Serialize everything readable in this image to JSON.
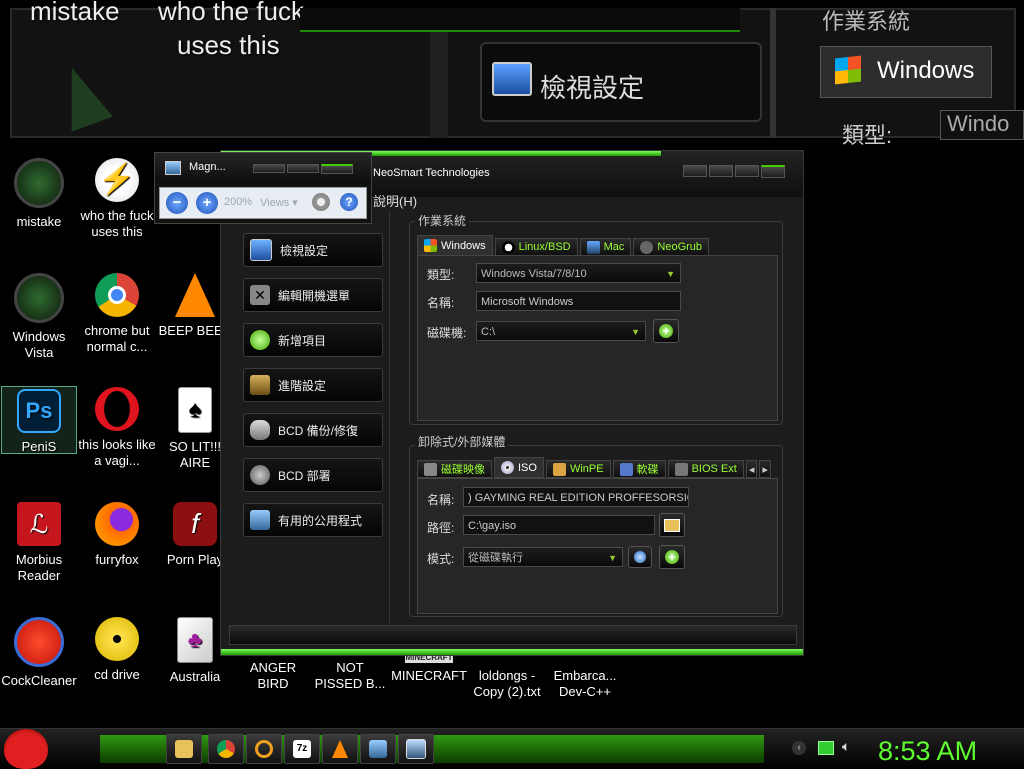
{
  "lens": {
    "texts": [
      "mistake",
      "who the fuck",
      "uses this"
    ],
    "view_settings": "檢視設定",
    "os_group_label": "作業系統",
    "os_tab": "Windows",
    "type_label": "類型:",
    "type_value": "Windo"
  },
  "desktop_icons": [
    {
      "label": "mistake"
    },
    {
      "label": "who the fuck uses this"
    },
    {
      "label": "Windows Vista"
    },
    {
      "label": "chrome but normal c..."
    },
    {
      "label": "BEEP BEEP"
    },
    {
      "label": "PeniS"
    },
    {
      "label": "this looks like a vagi..."
    },
    {
      "label": "SO LIT!!! AIRE"
    },
    {
      "label": "Morbius Reader"
    },
    {
      "label": "furryfox"
    },
    {
      "label": "Porn Play"
    },
    {
      "label": "CockCleaner"
    },
    {
      "label": "cd drive"
    },
    {
      "label": "Australia"
    },
    {
      "label": "ANGER BIRD"
    },
    {
      "label": "NOT PISSED B..."
    },
    {
      "label": "MINECRAFT"
    },
    {
      "label": "loldongs - Copy (2).txt"
    },
    {
      "label": "Embarca... Dev-C++"
    }
  ],
  "minecraft_badge": "MINECRAFT",
  "magnifier": {
    "title": "Magn...",
    "zoom": "200%",
    "views": "Views"
  },
  "easybcd": {
    "title": "NeoSmart Technologies",
    "menu_help": "說明(H)",
    "sidebar": [
      "檢視設定",
      "編輯開機選單",
      "新增項目",
      "進階設定",
      "BCD 備份/修復",
      "BCD 部署",
      "有用的公用程式"
    ],
    "os_group": {
      "title": "作業系統",
      "tabs": [
        "Windows",
        "Linux/BSD",
        "Mac",
        "NeoGrub"
      ],
      "type_label": "類型:",
      "type_value": "Windows Vista/7/8/10",
      "name_label": "名稱:",
      "name_value": "Microsoft Windows",
      "drive_label": "磁碟機:",
      "drive_value": "C:\\"
    },
    "removable_group": {
      "title": "卸除式/外部媒體",
      "tabs": [
        "磁碟映像",
        "ISO",
        "WinPE",
        "軟碟",
        "BIOS Ext"
      ],
      "name_label": "名稱:",
      "name_value": ") GAYMING REAL EDITION PROFFESORSIOA",
      "path_label": "路徑:",
      "path_value": "C:\\gay.iso",
      "mode_label": "模式:",
      "mode_value": "從磁碟執行"
    }
  },
  "clock": "8:53 AM",
  "colors": {
    "accent": "#5fff2f",
    "tab_text": "#99ff33"
  }
}
